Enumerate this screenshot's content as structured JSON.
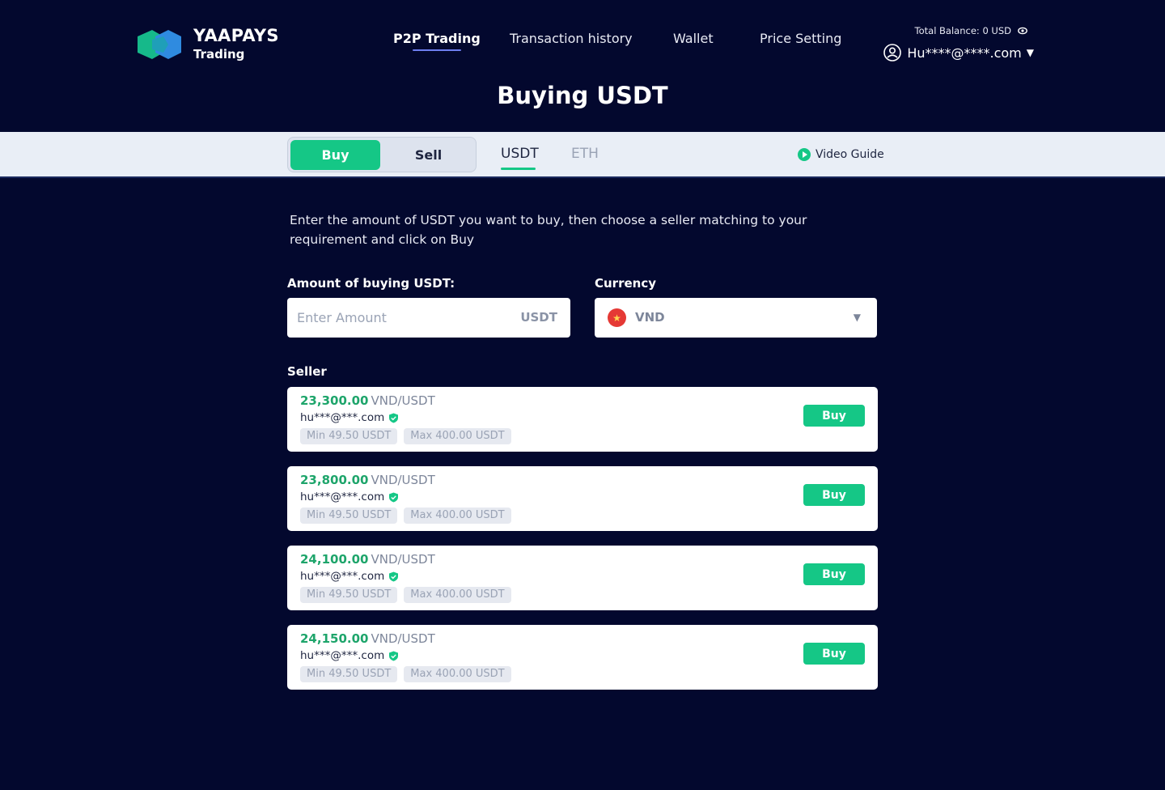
{
  "brand": {
    "name": "YAAPAYS",
    "sub": "Trading"
  },
  "nav": {
    "items": [
      {
        "label": "P2P Trading",
        "active": true
      },
      {
        "label": "Transaction history",
        "active": false
      },
      {
        "label": "Wallet",
        "active": false
      },
      {
        "label": "Price Setting",
        "active": false
      }
    ]
  },
  "account": {
    "balance_label": "Total Balance:",
    "balance_value": "0 USD",
    "user": "Hu****@****.com"
  },
  "page_title": "Buying USDT",
  "mode_tabs": {
    "buy": "Buy",
    "sell": "Sell",
    "active": "Buy"
  },
  "asset_tabs": {
    "usdt": "USDT",
    "eth": "ETH",
    "active": "USDT"
  },
  "video_guide": "Video Guide",
  "intro": "Enter the amount of USDT you want to buy, then choose a seller matching to your requirement and click on Buy",
  "amount": {
    "label": "Amount of buying USDT:",
    "placeholder": "Enter Amount",
    "value": "",
    "unit": "USDT"
  },
  "currency": {
    "label": "Currency",
    "value": "VND",
    "flag": "vietnam-flag"
  },
  "seller_label": "Seller",
  "offers": [
    {
      "price": "23,300.00",
      "pair": "VND/USDT",
      "seller": "hu***@***.com",
      "min": "Min 49.50 USDT",
      "max": "Max 400.00 USDT",
      "button": "Buy"
    },
    {
      "price": "23,800.00",
      "pair": "VND/USDT",
      "seller": "hu***@***.com",
      "min": "Min 49.50 USDT",
      "max": "Max 400.00 USDT",
      "button": "Buy"
    },
    {
      "price": "24,100.00",
      "pair": "VND/USDT",
      "seller": "hu***@***.com",
      "min": "Min 49.50 USDT",
      "max": "Max 400.00 USDT",
      "button": "Buy"
    },
    {
      "price": "24,150.00",
      "pair": "VND/USDT",
      "seller": "hu***@***.com",
      "min": "Min 49.50 USDT",
      "max": "Max 400.00 USDT",
      "button": "Buy"
    }
  ],
  "colors": {
    "background": "#03082e",
    "accent": "#15c786",
    "price": "#1ea56b",
    "nav_underline": "#6d7ef0",
    "tabbar": "#e9eef6"
  }
}
